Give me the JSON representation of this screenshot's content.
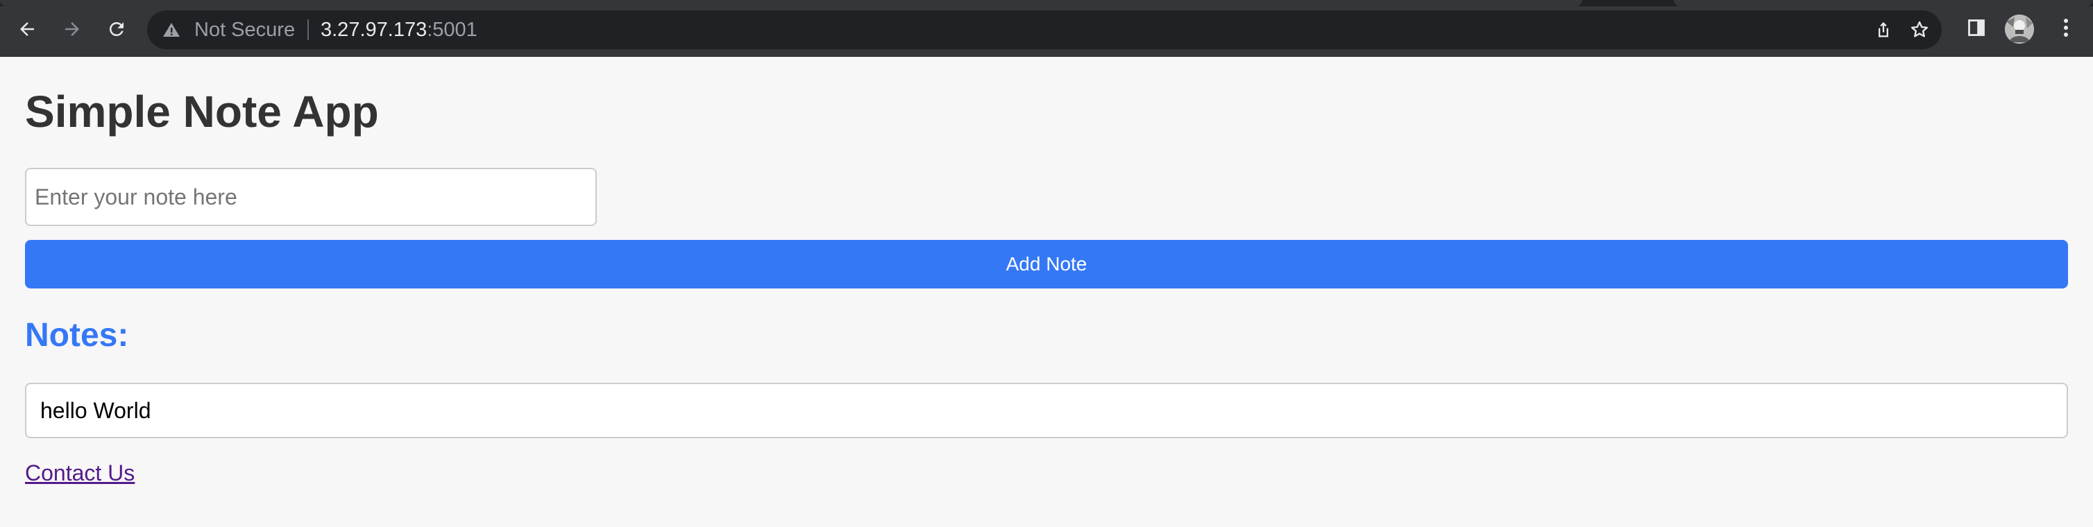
{
  "browser": {
    "security_label": "Not Secure",
    "url_host": "3.27.97.173",
    "url_port": ":5001",
    "icons": {
      "back": "back-arrow-icon",
      "forward": "forward-arrow-icon",
      "reload": "reload-icon",
      "warning": "warning-triangle-icon",
      "share": "share-icon",
      "bookmark": "bookmark-star-icon",
      "side_panel": "side-panel-icon",
      "profile": "profile-avatar",
      "menu": "kebab-menu-icon"
    },
    "colors": {
      "frame": "#202124",
      "toolbar": "#35363a",
      "omnibox": "#202124"
    }
  },
  "app": {
    "title": "Simple Note App",
    "note_input": {
      "placeholder": "Enter your note here",
      "value": ""
    },
    "add_button_label": "Add Note",
    "notes_heading": "Notes:",
    "notes": [
      {
        "text": "hello World"
      }
    ],
    "contact_link": "Contact Us",
    "colors": {
      "accent": "#3578f6",
      "title": "#333333",
      "background": "#f7f7f7",
      "visited_link": "#551a8b"
    }
  }
}
